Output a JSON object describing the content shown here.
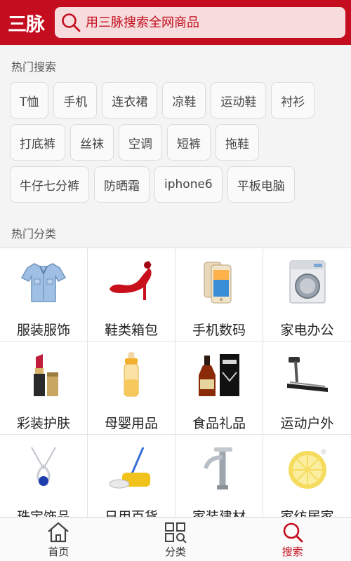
{
  "header": {
    "logo_text": "三脉",
    "search_placeholder": "用三脉搜索全网商品"
  },
  "hot_search": {
    "title": "热门搜索",
    "rows": [
      [
        "T恤",
        "手机",
        "连衣裙",
        "凉鞋",
        "运动鞋",
        "衬衫"
      ],
      [
        "打底裤",
        "丝袜",
        "空调",
        "短裤",
        "拖鞋"
      ],
      [
        "牛仔七分裤",
        "防晒霜",
        "iphone6",
        "平板电脑"
      ]
    ]
  },
  "hot_categories": {
    "title": "热门分类",
    "items": [
      {
        "label": "服装服饰",
        "icon": "shirt-icon"
      },
      {
        "label": "鞋类箱包",
        "icon": "high-heel-icon"
      },
      {
        "label": "手机数码",
        "icon": "phone-icon"
      },
      {
        "label": "家电办公",
        "icon": "washing-machine-icon"
      },
      {
        "label": "彩装护肤",
        "icon": "lipstick-icon"
      },
      {
        "label": "母婴用品",
        "icon": "baby-bottle-icon"
      },
      {
        "label": "食品礼品",
        "icon": "liquor-bottle-icon"
      },
      {
        "label": "运动户外",
        "icon": "treadmill-icon"
      },
      {
        "label": "珠宝饰品",
        "icon": "necklace-icon"
      },
      {
        "label": "日用百货",
        "icon": "mop-icon"
      },
      {
        "label": "家装建材",
        "icon": "faucet-icon"
      },
      {
        "label": "家纺居家",
        "icon": "lemon-cushion-icon"
      }
    ]
  },
  "tabbar": {
    "tabs": [
      {
        "label": "首页",
        "icon": "home-icon",
        "active": false
      },
      {
        "label": "分类",
        "icon": "category-grid-icon",
        "active": false
      },
      {
        "label": "搜索",
        "icon": "search-icon",
        "active": true
      }
    ]
  },
  "colors": {
    "brand": "#c40d1e",
    "search_bg": "#f6dcdc"
  }
}
